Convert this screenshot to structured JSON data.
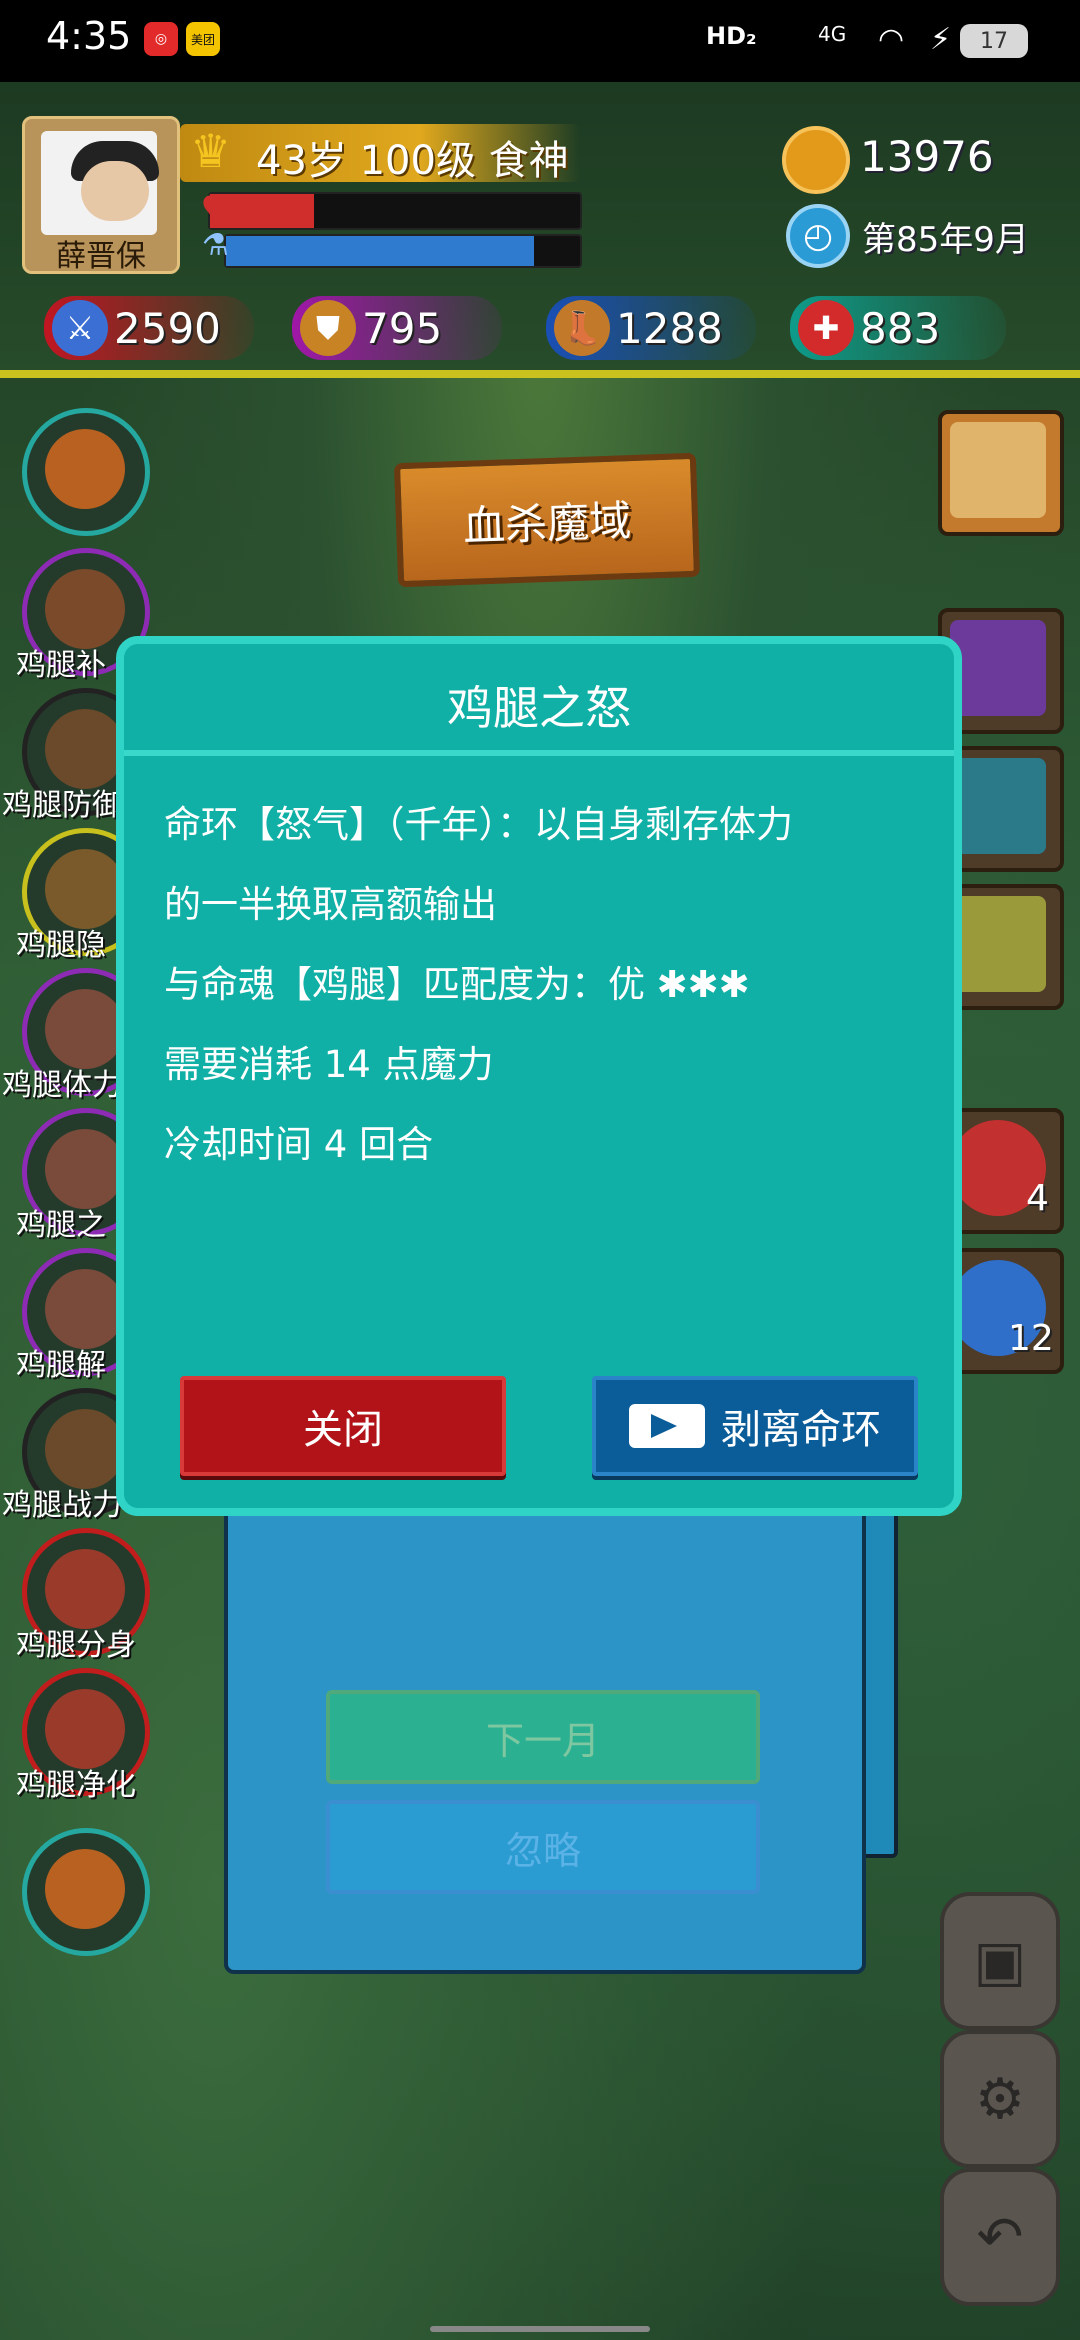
{
  "status_bar": {
    "time": "4:35",
    "badge1": "◎",
    "badge2": "美团",
    "hd": "HD₂",
    "signal": "4G",
    "battery": "17"
  },
  "player": {
    "name": "薛晋保",
    "level_text": "43岁 100级 食神",
    "coins": "13976",
    "date": "第85年9月",
    "hp_fraction": 0.28,
    "mp_fraction": 0.87
  },
  "stats": {
    "attack": "2590",
    "defense": "795",
    "speed": "1288",
    "health": "883"
  },
  "location_sign": "血杀魔域",
  "left_skills": [
    {
      "label": ""
    },
    {
      "label": "鸡腿补"
    },
    {
      "label": "鸡腿防御"
    },
    {
      "label": "鸡腿隐"
    },
    {
      "label": "鸡腿体力"
    },
    {
      "label": "鸡腿之"
    },
    {
      "label": "鸡腿解"
    },
    {
      "label": "鸡腿战力"
    },
    {
      "label": "鸡腿分身"
    },
    {
      "label": "鸡腿净化"
    },
    {
      "label": ""
    }
  ],
  "right_slots": {
    "red_potion_count": "4",
    "blue_potion_count": "12"
  },
  "dialog": {
    "title": "鸡腿之怒",
    "line1": "命环【怒气】（千年）：以自身剩存体力",
    "line2": "的一半换取高额输出",
    "line3": "与命魂【鸡腿】匹配度为：优 ✱✱✱",
    "line4": "需要消耗 14 点魔力",
    "line5": "冷却时间 4 回合",
    "close_label": "关闭",
    "strip_label": "剥离命环"
  },
  "background_panel": {
    "next_month_label": "下一月",
    "ignore_label": "忽略"
  },
  "colors": {
    "dialog_bg": "#11b0a6",
    "close_button": "#b11318",
    "strip_button": "#0b5d9a"
  }
}
